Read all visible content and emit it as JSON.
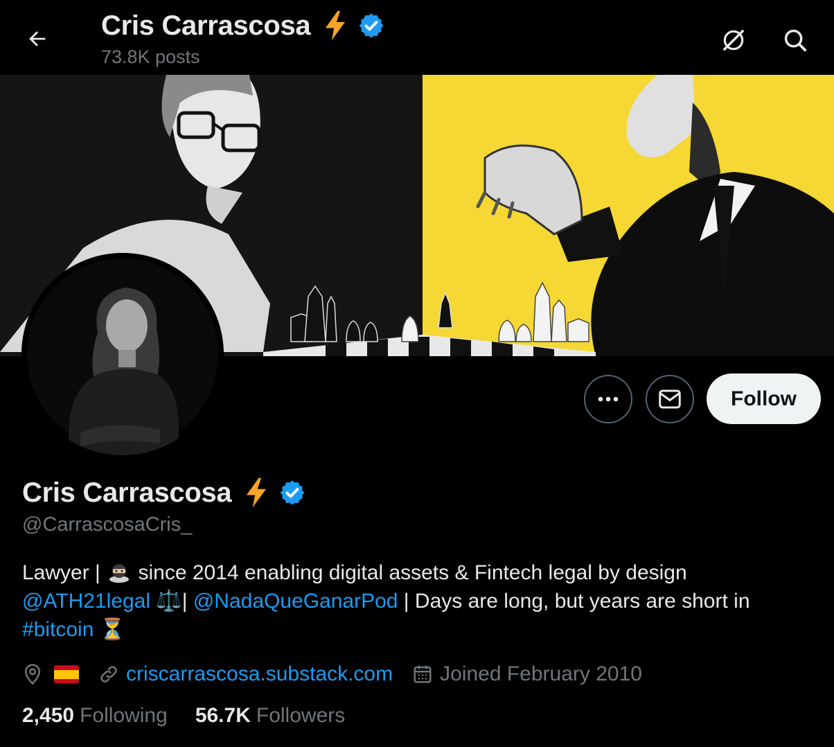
{
  "header": {
    "name": "Cris Carrascosa",
    "posts": "73.8K posts"
  },
  "actions": {
    "more_label": "More",
    "message_label": "Message",
    "follow_label": "Follow"
  },
  "profile": {
    "name": "Cris Carrascosa",
    "handle": "@CarrascosaCris_",
    "bio": {
      "line1_prefix": "Lawyer | ",
      "line1_text": " since 2014 enabling digital assets & Fintech legal by design",
      "mention1": "@ATH21legal",
      "scales": "⚖️",
      "sep": "| ",
      "mention2": "@NadaQueGanarPod",
      "line2_rest": " | Days are long, but years are short in",
      "hashtag": "#bitcoin",
      "hourglass": "⏳"
    },
    "flag": "🇪🇸",
    "website": "criscarrascosa.substack.com",
    "joined": "Joined February 2010",
    "following_count": "2,450",
    "following_label": "Following",
    "followers_count": "56.7K",
    "followers_label": "Followers"
  },
  "colors": {
    "link": "#1d9bf0",
    "verified": "#1d9bf0",
    "bolt": "#f7a427",
    "banner_yellow": "#f5d833"
  }
}
